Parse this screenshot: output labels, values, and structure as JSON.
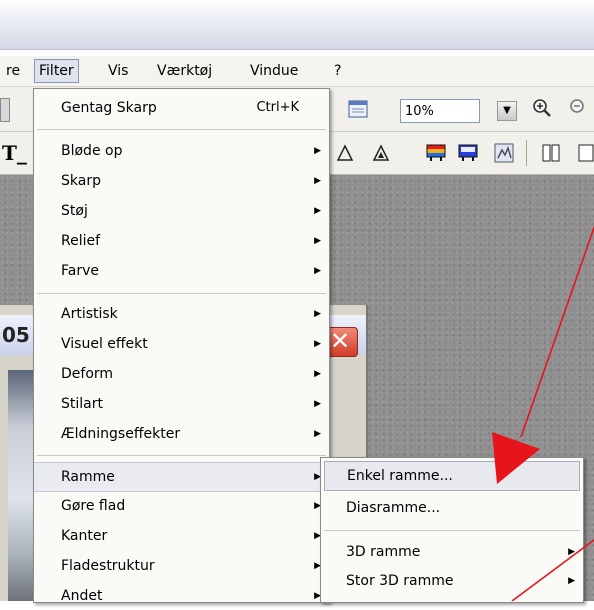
{
  "menubar": {
    "items": [
      {
        "label": "re"
      },
      {
        "label": "Filter"
      },
      {
        "label": "Vis"
      },
      {
        "label": "Værktøj"
      },
      {
        "label": "Vindue"
      },
      {
        "label": "?"
      }
    ]
  },
  "toolbar": {
    "zoom_value": "10%",
    "doc_tab_fragment": "T_"
  },
  "document": {
    "title_fragment": "05",
    "close_glyph": "✕"
  },
  "filter_menu": {
    "items": [
      {
        "label": "Gentag Skarp",
        "shortcut": "Ctrl+K"
      },
      {
        "label": "Bløde op"
      },
      {
        "label": "Skarp"
      },
      {
        "label": "Støj"
      },
      {
        "label": "Relief"
      },
      {
        "label": "Farve"
      },
      {
        "label": "Artistisk"
      },
      {
        "label": "Visuel effekt"
      },
      {
        "label": "Deform"
      },
      {
        "label": "Stilart"
      },
      {
        "label": "Ældningseffekter"
      },
      {
        "label": "Ramme"
      },
      {
        "label": "Gøre flad"
      },
      {
        "label": "Kanter"
      },
      {
        "label": "Fladestruktur"
      },
      {
        "label": "Andet"
      }
    ]
  },
  "ramme_submenu": {
    "items": [
      {
        "label": "Enkel ramme..."
      },
      {
        "label": "Diasramme..."
      },
      {
        "label": "3D ramme"
      },
      {
        "label": "Stor 3D ramme"
      }
    ]
  },
  "colors": {
    "annotation_arrow": "#e8141b",
    "menu_highlight": "#e9ebf0",
    "close_button": "#d23c25"
  }
}
